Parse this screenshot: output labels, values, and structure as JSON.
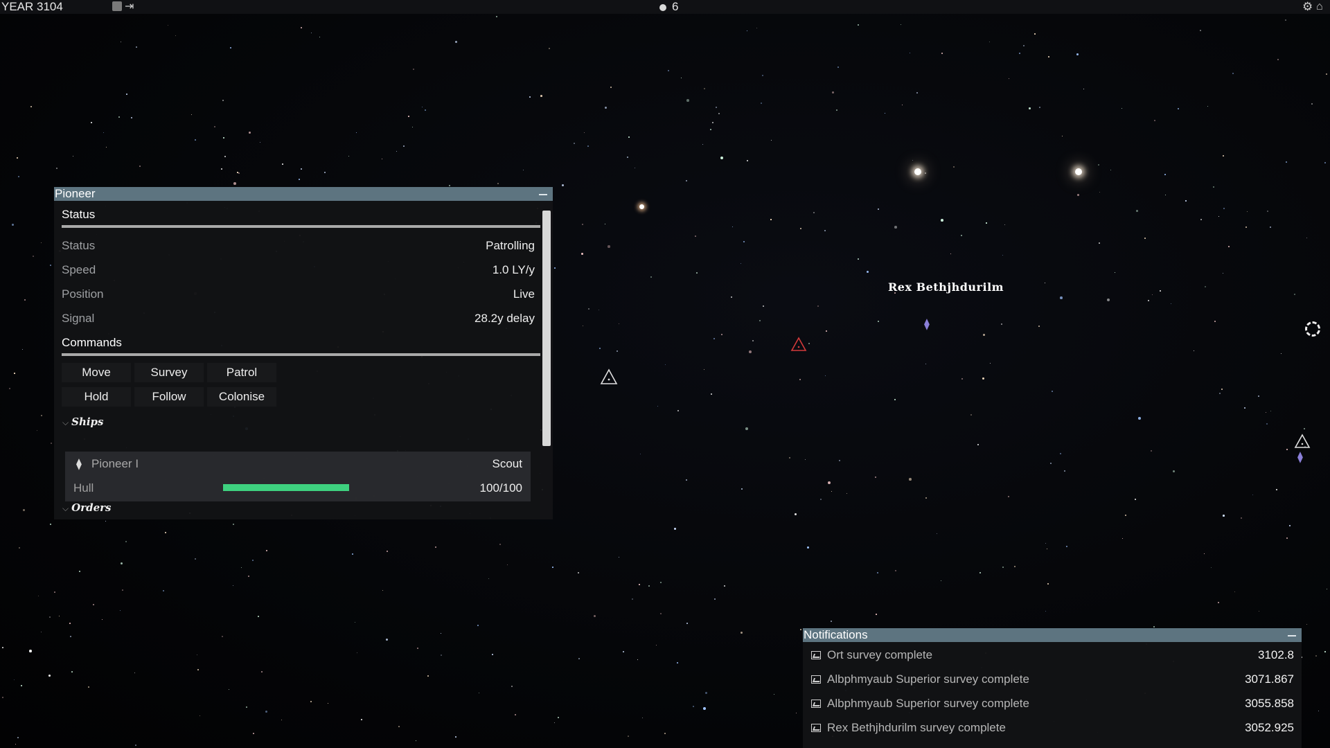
{
  "topbar": {
    "year_label": "YEAR 3104",
    "signal_count": "6",
    "icons": [
      "square-toggle-icon",
      "exit-arrow-icon",
      "signal-icon",
      "gear-icon",
      "home-icon"
    ]
  },
  "pioneer_panel": {
    "title": "Pioneer",
    "status_section": {
      "title": "Status",
      "rows": [
        {
          "key": "Status",
          "value": "Patrolling"
        },
        {
          "key": "Speed",
          "value": "1.0 LY/y"
        },
        {
          "key": "Position",
          "value": "Live"
        },
        {
          "key": "Signal",
          "value": "28.2y delay"
        }
      ]
    },
    "commands_section": {
      "title": "Commands",
      "buttons": [
        "Move",
        "Survey",
        "Patrol",
        "Hold",
        "Follow",
        "Colonise"
      ]
    },
    "ships_section": {
      "title": "Ships",
      "ship": {
        "name": "Pioneer I",
        "class": "Scout",
        "hull_label": "Hull",
        "hull_value": "100/100",
        "hull_fraction": 1.0,
        "hull_color": "#3ed17f"
      }
    },
    "orders_section": {
      "title": "Orders"
    }
  },
  "map": {
    "system_label": "Rex Bethjhdurilm"
  },
  "notifications": {
    "title": "Notifications",
    "items": [
      {
        "text": "Ort survey complete",
        "date": "3102.8"
      },
      {
        "text": "Albphmyaub Superior survey complete",
        "date": "3071.867"
      },
      {
        "text": "Albphmyaub Superior survey complete",
        "date": "3055.858"
      },
      {
        "text": "Rex Bethjhdurilm survey complete",
        "date": "3052.925"
      }
    ]
  },
  "colors": {
    "panel_header": "#5d7480",
    "hull_bar": "#3ed17f",
    "hostile_marker": "#d43a3a"
  }
}
